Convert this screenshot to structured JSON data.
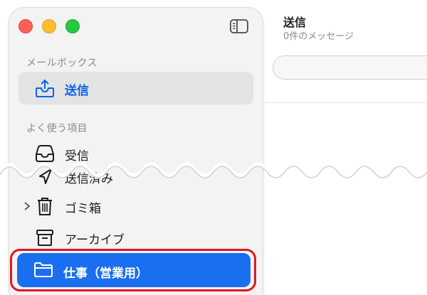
{
  "mailbox_section": {
    "header": "メールボックス",
    "items": [
      {
        "label": "送信",
        "icon": "outbox-tray-icon"
      }
    ]
  },
  "favorites_section": {
    "header": "よく使う項目",
    "items": [
      {
        "label": "受信",
        "icon": "inbox-tray-icon"
      },
      {
        "label": "送信済み",
        "icon": "paper-plane-icon"
      },
      {
        "label": "ゴミ箱",
        "icon": "trash-icon"
      },
      {
        "label": "アーカイブ",
        "icon": "archive-box-icon"
      },
      {
        "label": "仕事（営業用）",
        "icon": "folder-icon"
      }
    ]
  },
  "main": {
    "title": "送信",
    "subtitle": "0件のメッセージ"
  },
  "colors": {
    "accent": "#1a6ff0",
    "highlight": "#e0171f"
  }
}
